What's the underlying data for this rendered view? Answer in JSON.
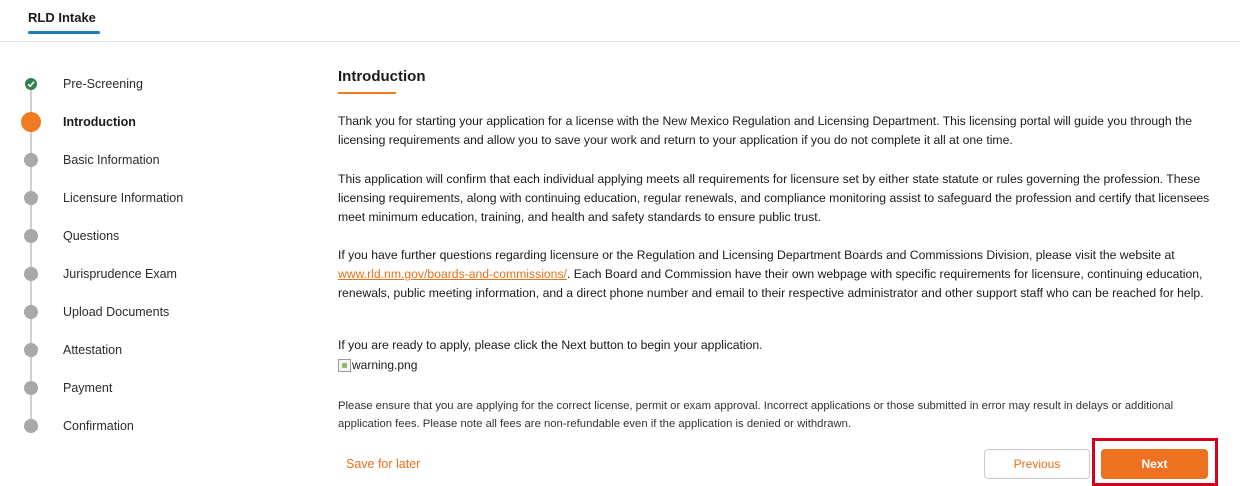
{
  "header": {
    "app_tab": "RLD Intake"
  },
  "stepper": {
    "steps": [
      {
        "label": "Pre-Screening",
        "status": "done"
      },
      {
        "label": "Introduction",
        "status": "current"
      },
      {
        "label": "Basic Information",
        "status": "pending"
      },
      {
        "label": "Licensure Information",
        "status": "pending"
      },
      {
        "label": "Questions",
        "status": "pending"
      },
      {
        "label": "Jurisprudence Exam",
        "status": "pending"
      },
      {
        "label": "Upload Documents",
        "status": "pending"
      },
      {
        "label": "Attestation",
        "status": "pending"
      },
      {
        "label": "Payment",
        "status": "pending"
      },
      {
        "label": "Confirmation",
        "status": "pending"
      }
    ]
  },
  "main": {
    "title": "Introduction",
    "p1": "Thank you for starting your application for a license with the New Mexico Regulation and Licensing Department. This licensing portal will guide you through the licensing requirements and allow you to save your work and return to your application if you do not complete it all at one time.",
    "p2": "This application will confirm that each individual applying meets all requirements for licensure set by either state statute or rules governing the profession. These licensing requirements, along with continuing education, regular renewals, and compliance monitoring assist to safeguard the profession and certify that licensees meet minimum education, training, and health and safety standards to ensure public trust.",
    "p3_before": "If you have further questions regarding licensure or the Regulation and Licensing Department Boards and Commissions Division, please visit the website at ",
    "p3_link": "www.rld.nm.gov/boards-and-commissions/",
    "p3_after": ". Each Board and Commission have their own webpage with specific requirements for licensure, continuing education, renewals, public meeting information, and a direct phone number and email to their respective administrator and other support staff who can be reached for help.",
    "p4": "If you are ready to apply, please click the Next button to begin your application.",
    "image_alt": "warning.png",
    "note": "Please ensure that you are applying for the correct license, permit or exam approval. Incorrect applications or those submitted in error may result in delays or additional application fees. Please note all fees are non-refundable even if the application is denied or withdrawn."
  },
  "footer": {
    "save_later": "Save for later",
    "previous": "Previous",
    "next": "Next"
  },
  "colors": {
    "accent": "#ec7120",
    "done": "#2e844a",
    "pending": "#a8a8a8",
    "highlight": "#d4001b"
  }
}
